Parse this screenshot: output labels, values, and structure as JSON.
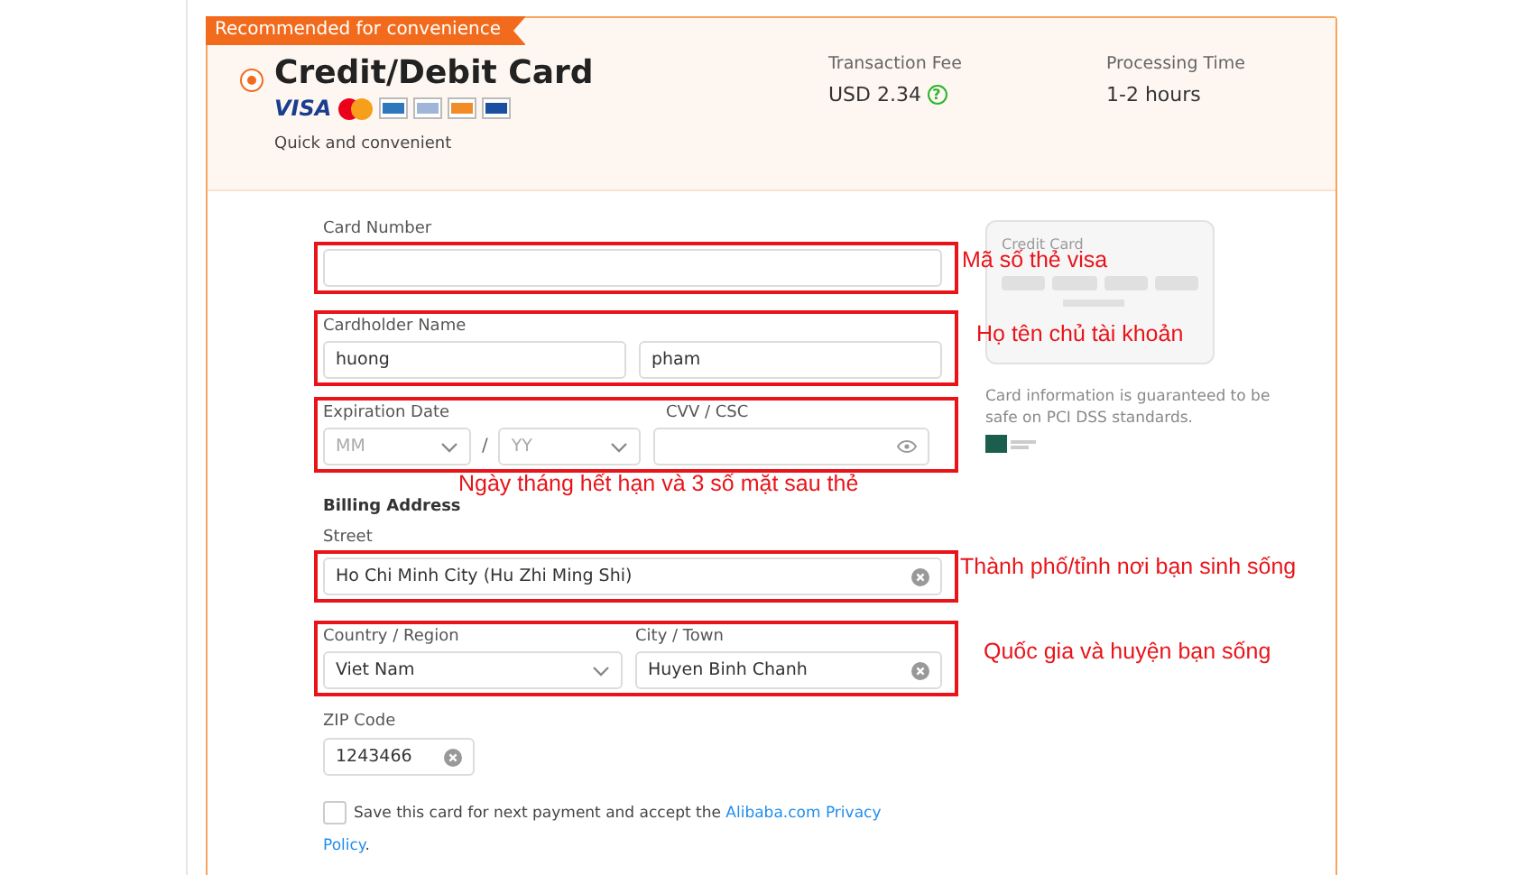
{
  "badge": "Recommended for convenience",
  "method": {
    "title": "Credit/Debit Card",
    "selected": true,
    "visa": "VISA",
    "subtitle": "Quick and convenient"
  },
  "fee": {
    "label": "Transaction Fee",
    "value": "USD 2.34",
    "help": "?"
  },
  "processing": {
    "label": "Processing Time",
    "value": "1-2 hours"
  },
  "card_number": {
    "label": "Card Number"
  },
  "cardholder": {
    "label": "Cardholder Name",
    "first": "huong",
    "last": "pham"
  },
  "expiration": {
    "label": "Expiration Date",
    "month": "MM",
    "slash": "/",
    "year": "YY"
  },
  "cvv": {
    "label": "CVV / CSC"
  },
  "billing": {
    "title": "Billing Address",
    "street_label": "Street",
    "street": "Ho Chi Minh City (Hu Zhi Ming Shi)",
    "country_label": "Country / Region",
    "country": "Viet Nam",
    "city_label": "City / Town",
    "city": "Huyen Binh Chanh",
    "zip_label": "ZIP Code",
    "zip": "1243466"
  },
  "save": {
    "checked": false,
    "text": "Save this card for next payment and accept the",
    "link": "Alibaba.com Privacy",
    "link2": "Policy",
    "end": "."
  },
  "card_preview": {
    "title": "Credit Card"
  },
  "security_note": "Card information is guaranteed to be safe on PCI DSS standards.",
  "annotations": [
    {
      "text": "Mã số thẻ visa"
    },
    {
      "text": "Họ tên chủ tài khoản"
    },
    {
      "text": "Ngày tháng hết hạn và 3 số mặt sau thẻ"
    },
    {
      "text": "Thành phố/tỉnh nơi bạn sinh sống"
    },
    {
      "text": "Quốc gia và huyện bạn sống"
    }
  ]
}
